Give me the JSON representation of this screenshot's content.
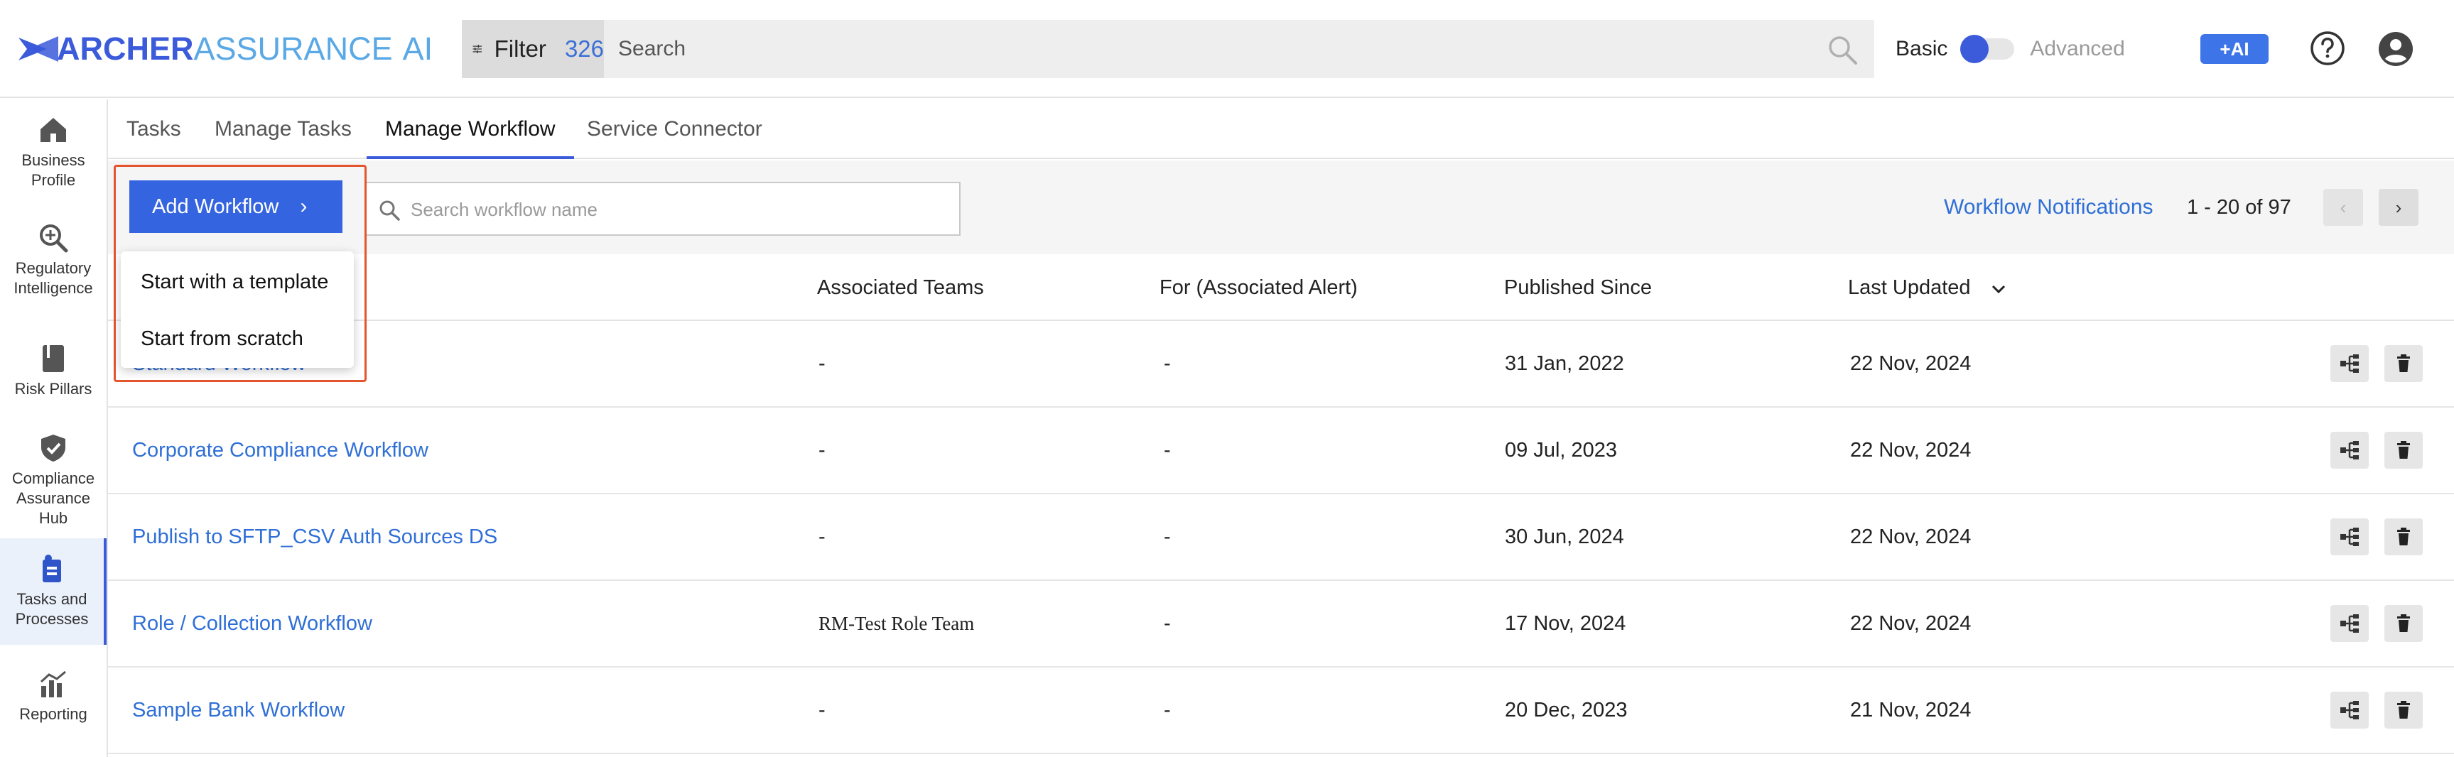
{
  "brand": {
    "word1": "ARCHER",
    "word2": "ASSURANCE",
    "word3": "AI"
  },
  "search": {
    "filter_label": "Filter",
    "filter_count": "326",
    "placeholder": "Search"
  },
  "mode": {
    "basic": "Basic",
    "advanced": "Advanced"
  },
  "ai_button": "+AI",
  "nav": [
    {
      "label1": "Business",
      "label2": "Profile",
      "icon": "home-icon"
    },
    {
      "label1": "Regulatory",
      "label2": "Intelligence",
      "icon": "zoom-search-icon"
    },
    {
      "label1": "Risk Pillars",
      "label2": "",
      "icon": "book-icon"
    },
    {
      "label1": "Compliance",
      "label2": "Assurance",
      "label3": "Hub",
      "icon": "shield-check-icon"
    },
    {
      "label1": "Tasks and",
      "label2": "Processes",
      "icon": "tasks-icon"
    },
    {
      "label1": "Reporting",
      "label2": "",
      "icon": "chart-icon"
    }
  ],
  "tabs": [
    "Tasks",
    "Manage Tasks",
    "Manage Workflow",
    "Service Connector"
  ],
  "toolbar": {
    "add_workflow": "Add Workflow",
    "search_placeholder": "Search workflow name",
    "notifications": "Workflow Notifications",
    "pager": "1 - 20 of 97"
  },
  "dropdown": {
    "template": "Start with a template",
    "scratch": "Start from scratch"
  },
  "columns": {
    "teams": "Associated Teams",
    "alert": "For (Associated Alert)",
    "published": "Published Since",
    "updated": "Last Updated"
  },
  "rows": [
    {
      "name": "Standard Workflow",
      "teams": "-",
      "alert": "-",
      "published": "31 Jan, 2022",
      "updated": "22 Nov, 2024"
    },
    {
      "name": "Corporate Compliance Workflow",
      "teams": "-",
      "alert": "-",
      "published": "09 Jul, 2023",
      "updated": "22 Nov, 2024"
    },
    {
      "name": "Publish to SFTP_CSV Auth Sources DS",
      "teams": "-",
      "alert": "-",
      "published": "30 Jun, 2024",
      "updated": "22 Nov, 2024"
    },
    {
      "name": "Role / Collection Workflow",
      "teams": "RM-Test Role Team",
      "alert": "-",
      "published": "17 Nov, 2024",
      "updated": "22 Nov, 2024"
    },
    {
      "name": "Sample Bank Workflow",
      "teams": "-",
      "alert": "-",
      "published": "20 Dec, 2023",
      "updated": "21 Nov, 2024"
    }
  ],
  "colors": {
    "accent": "#3464e0",
    "link": "#2f6fd6",
    "highlight": "#e2552f"
  }
}
